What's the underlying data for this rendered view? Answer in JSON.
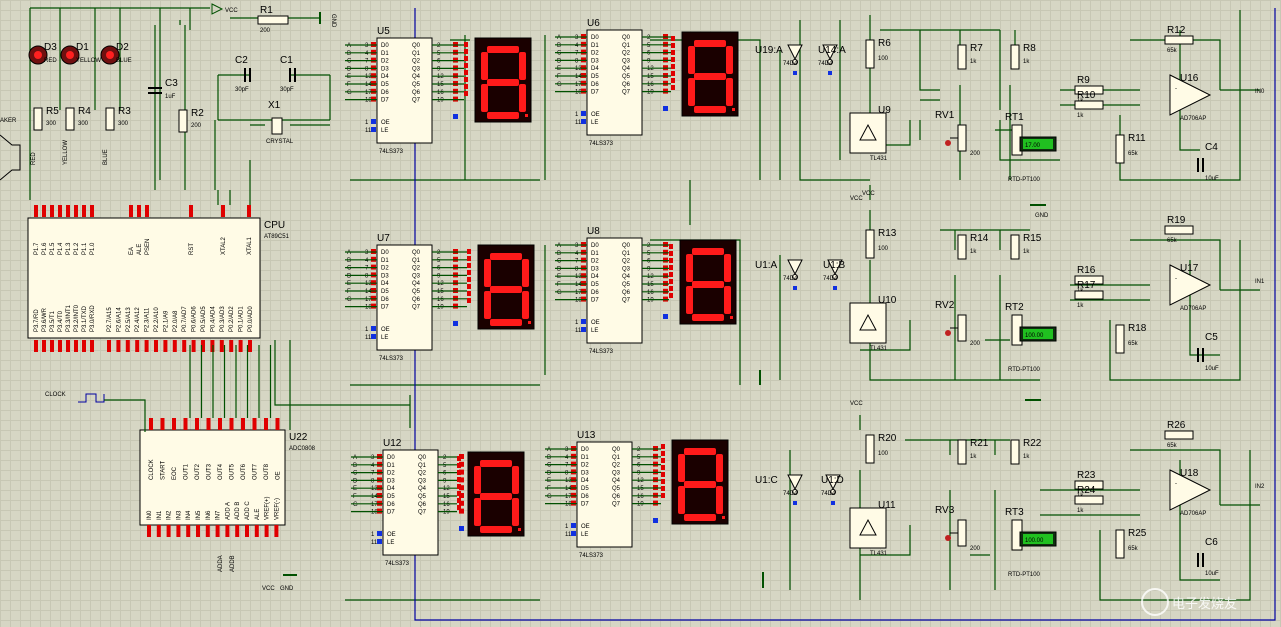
{
  "cpu": {
    "ref": "CPU",
    "part": "AT89C51",
    "left_pins": [
      "P3.7/RD",
      "P3.6/WR",
      "P3.5/T1",
      "P3.4/T0",
      "P3.3/INT1",
      "P3.2/INT0",
      "P3.1/TXD",
      "P3.0/RXD"
    ],
    "right_pins": [
      "P2.7/A15",
      "P2.6/A14",
      "P2.5/A13",
      "P2.4/A12",
      "P2.3/A11",
      "P2.2/A10",
      "P2.1/A9",
      "P2.0/A8",
      "P0.7/AD7",
      "P0.6/AD6",
      "P0.5/AD5",
      "P0.4/AD4",
      "P0.3/AD3",
      "P0.2/AD2",
      "P0.1/AD1",
      "P0.0/AD0"
    ],
    "top_pins": [
      "P1.7",
      "P1.6",
      "P1.5",
      "P1.4",
      "P1.3",
      "P1.2",
      "P1.1",
      "P1.0",
      "EA",
      "ALE",
      "PSEN",
      "RST",
      "XTAL2",
      "XTAL1"
    ]
  },
  "adc": {
    "ref": "U22",
    "part": "ADC0808",
    "pins_top": [
      "CLOCK",
      "START",
      "EOC",
      "OUT1",
      "OUT2",
      "OUT3",
      "OUT4",
      "OUT5",
      "OUT6",
      "OUT7",
      "OUT8",
      "OE"
    ],
    "pins_bottom": [
      "IN0",
      "IN1",
      "IN2",
      "IN3",
      "IN4",
      "IN5",
      "IN6",
      "IN7",
      "ADD A",
      "ADD B",
      "ADD C",
      "ALE",
      "VREF(+)",
      "VREF(-)"
    ],
    "nets": [
      "ADDA",
      "ADDB"
    ]
  },
  "clock": {
    "label": "CLOCK"
  },
  "leds": [
    {
      "ref": "D3",
      "color": "RED"
    },
    {
      "ref": "D1",
      "color": "YELLOW"
    },
    {
      "ref": "D2",
      "color": "BLUE"
    }
  ],
  "resistors_top": [
    {
      "ref": "R5",
      "value": "300"
    },
    {
      "ref": "R4",
      "value": "300"
    },
    {
      "ref": "R3",
      "value": "300"
    },
    {
      "ref": "R1",
      "value": "200"
    },
    {
      "ref": "R2",
      "value": "200"
    }
  ],
  "nets_left": [
    "RED",
    "YELLOW",
    "BLUE"
  ],
  "caps_top": [
    {
      "ref": "C3",
      "value": "1uF"
    },
    {
      "ref": "C2",
      "value": "30pF"
    },
    {
      "ref": "C1",
      "value": "30pF"
    }
  ],
  "crystal": {
    "ref": "X1",
    "label": "CRYSTAL"
  },
  "speaker": "AKER",
  "latches": [
    {
      "ref": "U5"
    },
    {
      "ref": "U6"
    },
    {
      "ref": "U7"
    },
    {
      "ref": "U8"
    },
    {
      "ref": "U12"
    },
    {
      "ref": "U13"
    }
  ],
  "latch_part": "74LS373",
  "latch_in_pins": [
    "D0",
    "D1",
    "D2",
    "D3",
    "D4",
    "D5",
    "D6",
    "D7"
  ],
  "latch_out_pins": [
    "Q0",
    "Q1",
    "Q2",
    "Q3",
    "Q4",
    "Q5",
    "Q6",
    "Q7"
  ],
  "latch_ctrl": [
    "OE",
    "LE"
  ],
  "seg_labels": [
    "A",
    "B",
    "C",
    "D",
    "E",
    "F",
    "G"
  ],
  "in_pin_nums": [
    "3",
    "4",
    "7",
    "8",
    "13",
    "14",
    "17",
    "18"
  ],
  "out_pin_nums": [
    "2",
    "5",
    "6",
    "9",
    "12",
    "15",
    "16",
    "19"
  ],
  "ctrl_pin_nums": [
    "1",
    "11"
  ],
  "inverters": [
    {
      "a": "U19:A",
      "b": "U14:A"
    },
    {
      "a": "U1:A",
      "b": "U1:B"
    },
    {
      "a": "U1:C",
      "b": "U1:D"
    }
  ],
  "inv_part": "74D4",
  "channels": [
    {
      "shunt": "U9",
      "r_vcc": "R6",
      "r_vcc_val": "100",
      "ra": "R7",
      "rb": "R8",
      "r_val": "1k",
      "rin1": "R9",
      "rin2": "R10",
      "r_gnd": "R11",
      "r_gnd_val": "65k",
      "rf": "R12",
      "rf_val": "65k",
      "pot": "RV1",
      "pot_val": "200",
      "rtd": "RT1",
      "rtd_val": "17.00",
      "cap": "C4",
      "cap_val": "10uF",
      "opamp": "U16",
      "out": "IN0"
    },
    {
      "shunt": "U10",
      "r_vcc": "R13",
      "r_vcc_val": "100",
      "ra": "R14",
      "rb": "R15",
      "r_val": "1k",
      "rin1": "R16",
      "rin2": "R17",
      "r_gnd": "R18",
      "r_gnd_val": "65k",
      "rf": "R19",
      "rf_val": "65k",
      "pot": "RV2",
      "pot_val": "200",
      "rtd": "RT2",
      "rtd_val": "100.00",
      "cap": "C5",
      "cap_val": "10uF",
      "opamp": "U17",
      "out": "IN1"
    },
    {
      "shunt": "U11",
      "r_vcc": "R20",
      "r_vcc_val": "100",
      "ra": "R21",
      "rb": "R22",
      "r_val": "1k",
      "rin1": "R23",
      "rin2": "R24",
      "r_gnd": "R25",
      "r_gnd_val": "65k",
      "rf": "R26",
      "rf_val": "65k",
      "pot": "RV3",
      "pot_val": "200",
      "rtd": "RT3",
      "rtd_val": "100.00",
      "cap": "C6",
      "cap_val": "10uF",
      "opamp": "U18",
      "out": "IN2"
    }
  ],
  "shunt_part": "TL431",
  "rtd_part": "RTD-PT100",
  "opamp_part": "AD706AP",
  "rails": {
    "vcc": "VCC",
    "gnd": "GND"
  },
  "watermark": "电子发烧友"
}
